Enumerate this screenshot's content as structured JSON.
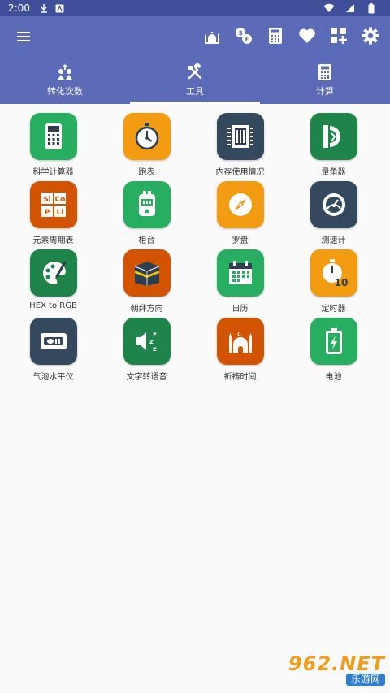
{
  "status_bar": {
    "time": "2:00"
  },
  "app_bar": {
    "actions": [
      {
        "name": "mosque-icon-button"
      },
      {
        "name": "currency-exchange-icon-button"
      },
      {
        "name": "calculator-icon-button"
      },
      {
        "name": "favorite-heart-icon-button"
      },
      {
        "name": "add-widget-icon-button"
      },
      {
        "name": "settings-gear-icon-button"
      }
    ]
  },
  "tabs": [
    {
      "label": "转化次数",
      "icon": "conversion-icon",
      "active": false
    },
    {
      "label": "工具",
      "icon": "tools-icon",
      "active": true
    },
    {
      "label": "计算",
      "icon": "calculator-icon",
      "active": false
    }
  ],
  "tools": [
    {
      "label": "科学计算器",
      "icon": "scientific-calculator-icon",
      "color": "#27ae60"
    },
    {
      "label": "跑表",
      "icon": "stopwatch-icon",
      "color": "#f39c12"
    },
    {
      "label": "内存使用情况",
      "icon": "memory-chip-icon",
      "color": "#34495e"
    },
    {
      "label": "量角器",
      "icon": "protractor-icon",
      "color": "#1e8449"
    },
    {
      "label": "元素周期表",
      "icon": "periodic-table-icon",
      "color": "#d35400"
    },
    {
      "label": "柜台",
      "icon": "counter-icon",
      "color": "#27ae60"
    },
    {
      "label": "罗盘",
      "icon": "compass-icon",
      "color": "#f39c12"
    },
    {
      "label": "测速计",
      "icon": "speedometer-icon",
      "color": "#34495e"
    },
    {
      "label": "HEX to RGB",
      "icon": "palette-icon",
      "color": "#1e8449"
    },
    {
      "label": "朝拜方向",
      "icon": "kaaba-icon",
      "color": "#d35400"
    },
    {
      "label": "日历",
      "icon": "calendar-icon",
      "color": "#27ae60"
    },
    {
      "label": "定时器",
      "icon": "timer-icon",
      "color": "#f39c12"
    },
    {
      "label": "气泡水平仪",
      "icon": "bubble-level-icon",
      "color": "#34495e"
    },
    {
      "label": "文字转语音",
      "icon": "text-to-speech-icon",
      "color": "#1e8449"
    },
    {
      "label": "祈祷时间",
      "icon": "mosque-icon",
      "color": "#d35400"
    },
    {
      "label": "电池",
      "icon": "battery-icon",
      "color": "#27ae60"
    }
  ],
  "watermark": {
    "top": "962.NET",
    "bottom": "乐游网"
  }
}
